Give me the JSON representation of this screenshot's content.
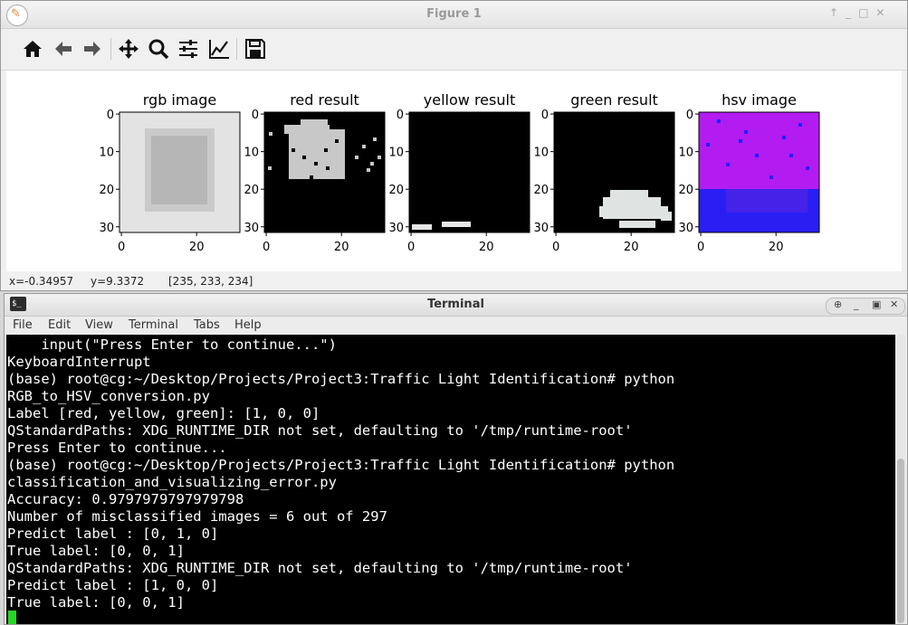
{
  "figure_window": {
    "title": "Figure 1",
    "status": {
      "x": "x=-0.34957",
      "y": "y=9.3372",
      "pixel": "[235, 233, 234]"
    },
    "toolbar": [
      "home-icon",
      "back-arrow-icon",
      "forward-arrow-icon",
      "pan-icon",
      "zoom-icon",
      "subplots-icon",
      "axes-edit-icon",
      "save-icon"
    ]
  },
  "chart_data": [
    {
      "type": "heatmap",
      "title": "rgb image",
      "xlim": [
        -0.5,
        31.5
      ],
      "ylim": [
        31.5,
        -0.5
      ],
      "xticks": [
        "0",
        "20"
      ],
      "yticks": [
        "0",
        "10",
        "20",
        "30"
      ],
      "grid": false,
      "description_colors": {
        "background": "#e3e3e3",
        "frame": "#cacaca",
        "inner": "#b6b6b6"
      }
    },
    {
      "type": "heatmap",
      "title": "red result",
      "xlim": [
        -0.5,
        31.5
      ],
      "ylim": [
        31.5,
        -0.5
      ],
      "xticks": [
        "0",
        "20"
      ],
      "yticks": [
        "0",
        "10",
        "20",
        "30"
      ],
      "grid": false,
      "description_colors": {
        "background": "#000000",
        "mask": "#c8c8c8"
      }
    },
    {
      "type": "heatmap",
      "title": "yellow result",
      "xlim": [
        -0.5,
        31.5
      ],
      "ylim": [
        31.5,
        -0.5
      ],
      "xticks": [
        "0",
        "20"
      ],
      "yticks": [
        "0",
        "10",
        "20",
        "30"
      ],
      "grid": false,
      "description_colors": {
        "background": "#000000",
        "mask": "#e6e6e6"
      }
    },
    {
      "type": "heatmap",
      "title": "green result",
      "xlim": [
        -0.5,
        31.5
      ],
      "ylim": [
        31.5,
        -0.5
      ],
      "xticks": [
        "0",
        "20"
      ],
      "yticks": [
        "0",
        "10",
        "20",
        "30"
      ],
      "grid": false,
      "description_colors": {
        "background": "#000000",
        "mask": "#dfe3e2"
      }
    },
    {
      "type": "heatmap",
      "title": "hsv image",
      "xlim": [
        -0.5,
        31.5
      ],
      "ylim": [
        31.5,
        -0.5
      ],
      "xticks": [
        "0",
        "20"
      ],
      "yticks": [
        "0",
        "10",
        "20",
        "30"
      ],
      "grid": false,
      "description_colors": {
        "top": "#b21cf0",
        "bottom": "#2a1ef2",
        "dots": "#2020ff"
      }
    }
  ],
  "terminal": {
    "title": "Terminal",
    "menu": [
      "File",
      "Edit",
      "View",
      "Terminal",
      "Tabs",
      "Help"
    ],
    "lines": [
      "    input(\"Press Enter to continue...\")",
      "KeyboardInterrupt",
      "(base) root@cg:~/Desktop/Projects/Project3:Traffic Light Identification# python",
      "RGB_to_HSV_conversion.py",
      "Label [red, yellow, green]: [1, 0, 0]",
      "QStandardPaths: XDG_RUNTIME_DIR not set, defaulting to '/tmp/runtime-root'",
      "Press Enter to continue...",
      "(base) root@cg:~/Desktop/Projects/Project3:Traffic Light Identification# python",
      "classification_and_visualizing_error.py",
      "Accuracy: 0.9797979797979798",
      "Number of misclassified images = 6 out of 297",
      "Predict label : [0, 1, 0]",
      "True label: [0, 0, 1]",
      "QStandardPaths: XDG_RUNTIME_DIR not set, defaulting to '/tmp/runtime-root'",
      "Predict label : [1, 0, 0]",
      "True label: [0, 0, 1]"
    ],
    "colors": {
      "background": "#000000",
      "text": "#ffffff",
      "cursor": "#27d427"
    }
  }
}
